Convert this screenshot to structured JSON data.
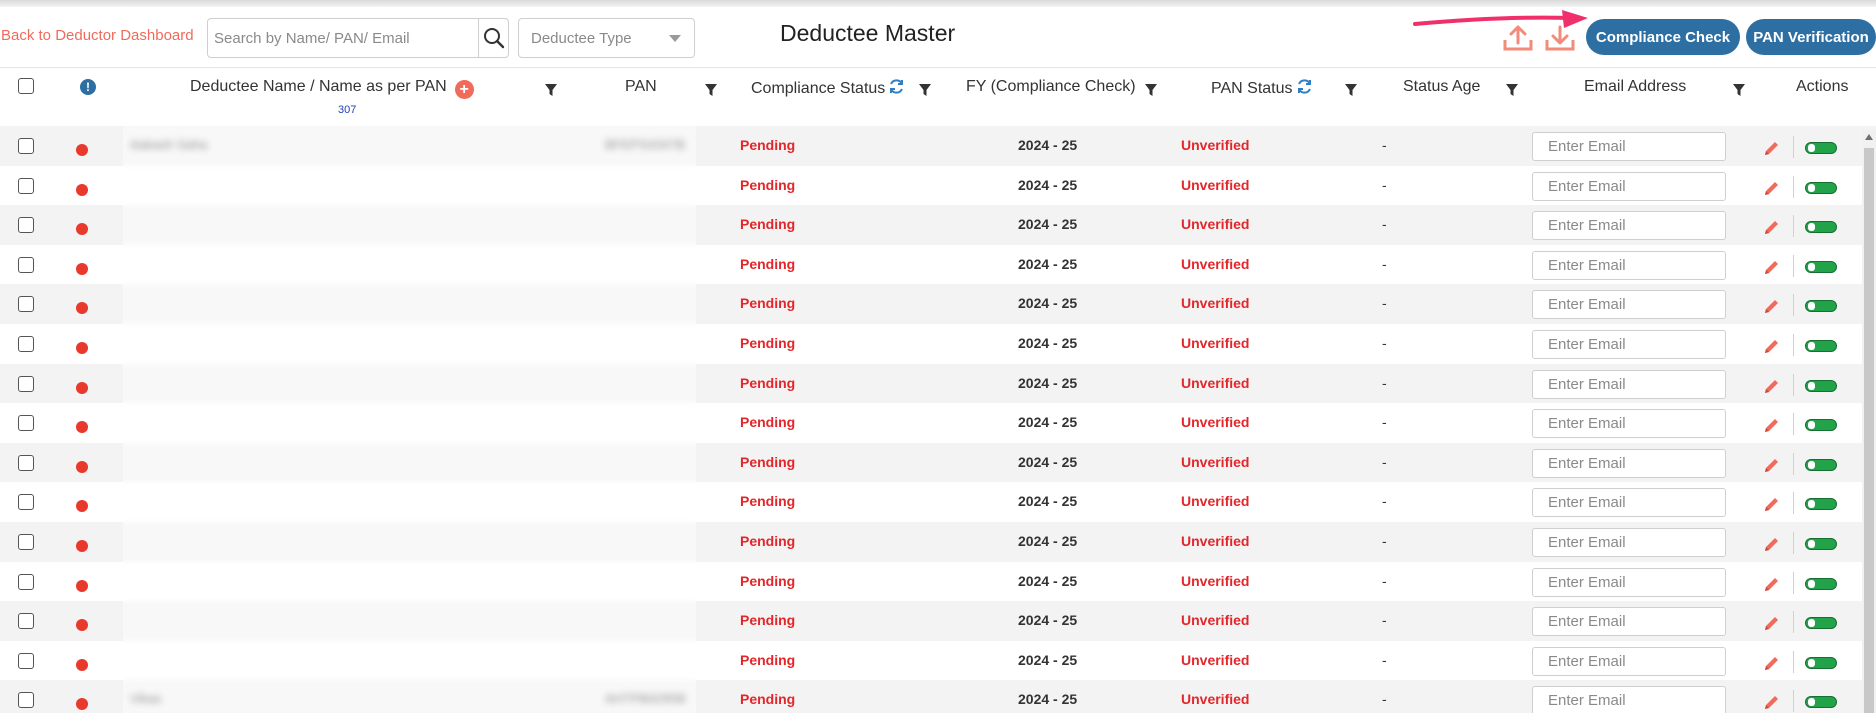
{
  "header": {
    "back_link": "Back to Deductor Dashboard",
    "search_placeholder": "Search by Name/ PAN/ Email",
    "deductee_type_placeholder": "Deductee Type",
    "title": "Deductee Master",
    "compliance_check_label": "Compliance Check",
    "pan_verification_label": "PAN Verification"
  },
  "columns": {
    "name": "Deductee Name / Name as per PAN",
    "count": "307",
    "pan": "PAN",
    "compliance_status": "Compliance Status",
    "fy": "FY (Compliance Check)",
    "pan_status": "PAN Status",
    "status_age": "Status Age",
    "email": "Email Address",
    "actions": "Actions"
  },
  "colors": {
    "accent": "#2e6fa3",
    "link": "#f06b5b",
    "status_red": "#e3262a",
    "toggle_green": "#22a34a"
  },
  "rows": [
    {
      "name": "Aakash Saha",
      "pan": "BFEPS4347B",
      "status": "Pending",
      "fy": "2024 - 25",
      "pan_status": "Unverified",
      "age": "-",
      "email_placeholder": "Enter Email"
    },
    {
      "name": "",
      "pan": "",
      "status": "Pending",
      "fy": "2024 - 25",
      "pan_status": "Unverified",
      "age": "-",
      "email_placeholder": "Enter Email"
    },
    {
      "name": "",
      "pan": "",
      "status": "Pending",
      "fy": "2024 - 25",
      "pan_status": "Unverified",
      "age": "-",
      "email_placeholder": "Enter Email"
    },
    {
      "name": "",
      "pan": "",
      "status": "Pending",
      "fy": "2024 - 25",
      "pan_status": "Unverified",
      "age": "-",
      "email_placeholder": "Enter Email"
    },
    {
      "name": "",
      "pan": "",
      "status": "Pending",
      "fy": "2024 - 25",
      "pan_status": "Unverified",
      "age": "-",
      "email_placeholder": "Enter Email"
    },
    {
      "name": "",
      "pan": "",
      "status": "Pending",
      "fy": "2024 - 25",
      "pan_status": "Unverified",
      "age": "-",
      "email_placeholder": "Enter Email"
    },
    {
      "name": "",
      "pan": "",
      "status": "Pending",
      "fy": "2024 - 25",
      "pan_status": "Unverified",
      "age": "-",
      "email_placeholder": "Enter Email"
    },
    {
      "name": "",
      "pan": "",
      "status": "Pending",
      "fy": "2024 - 25",
      "pan_status": "Unverified",
      "age": "-",
      "email_placeholder": "Enter Email"
    },
    {
      "name": "",
      "pan": "",
      "status": "Pending",
      "fy": "2024 - 25",
      "pan_status": "Unverified",
      "age": "-",
      "email_placeholder": "Enter Email"
    },
    {
      "name": "",
      "pan": "",
      "status": "Pending",
      "fy": "2024 - 25",
      "pan_status": "Unverified",
      "age": "-",
      "email_placeholder": "Enter Email"
    },
    {
      "name": "",
      "pan": "",
      "status": "Pending",
      "fy": "2024 - 25",
      "pan_status": "Unverified",
      "age": "-",
      "email_placeholder": "Enter Email"
    },
    {
      "name": "",
      "pan": "",
      "status": "Pending",
      "fy": "2024 - 25",
      "pan_status": "Unverified",
      "age": "-",
      "email_placeholder": "Enter Email"
    },
    {
      "name": "",
      "pan": "",
      "status": "Pending",
      "fy": "2024 - 25",
      "pan_status": "Unverified",
      "age": "-",
      "email_placeholder": "Enter Email"
    },
    {
      "name": "",
      "pan": "",
      "status": "Pending",
      "fy": "2024 - 25",
      "pan_status": "Unverified",
      "age": "-",
      "email_placeholder": "Enter Email"
    },
    {
      "name": "Vikas",
      "pan": "AHTPB9295B",
      "status": "Pending",
      "fy": "2024 - 25",
      "pan_status": "Unverified",
      "age": "-",
      "email_placeholder": "Enter Email"
    }
  ]
}
